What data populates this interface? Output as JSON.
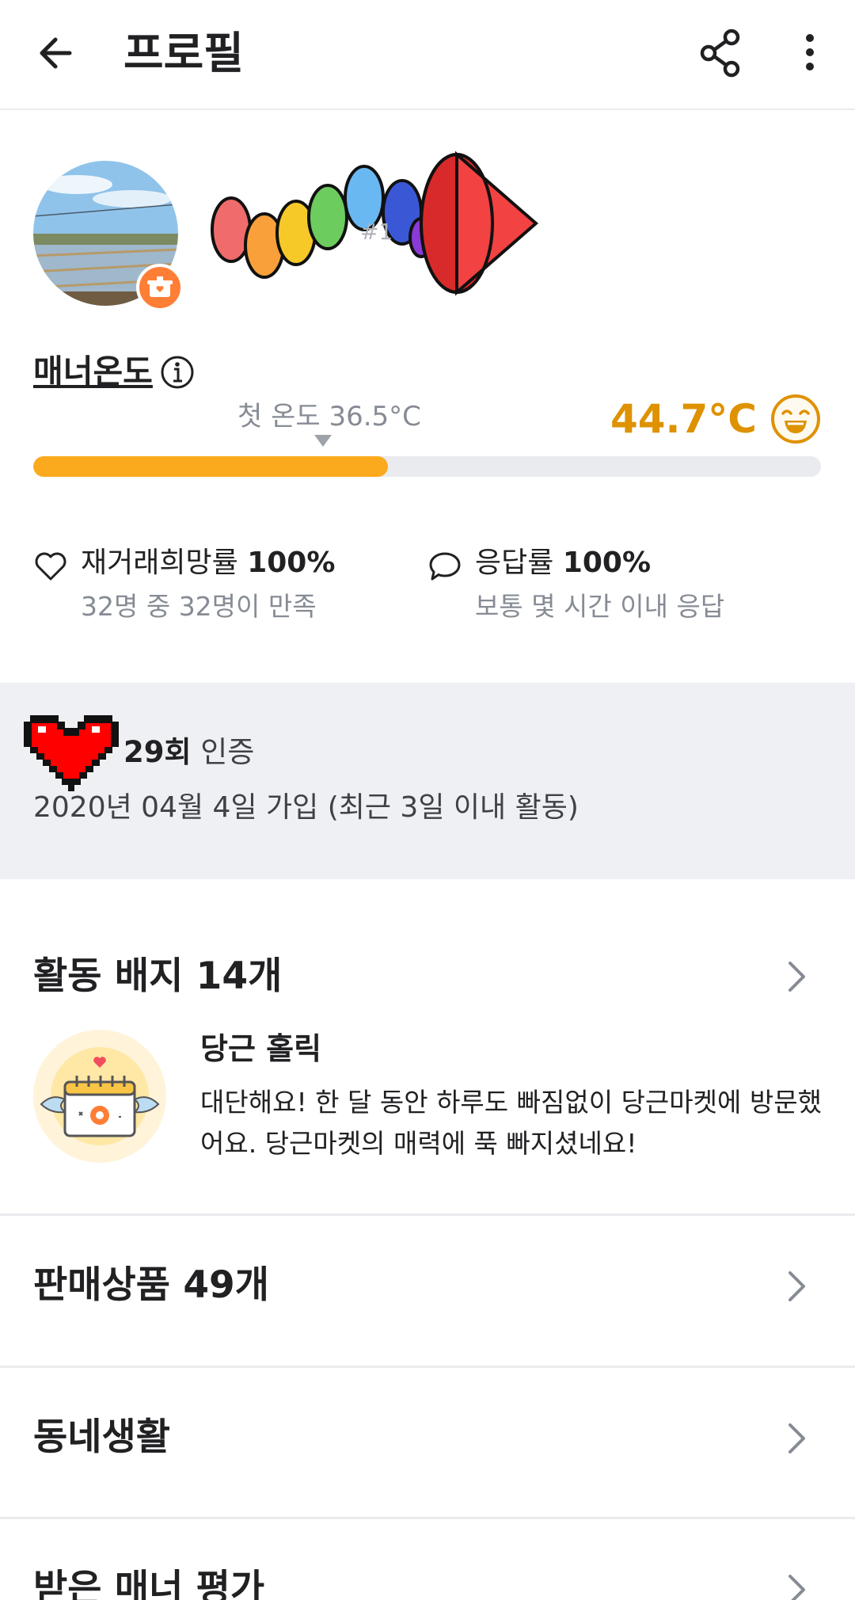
{
  "header": {
    "title": "프로필",
    "back_icon": "arrow-left-icon",
    "share_icon": "share-icon",
    "more_icon": "more-vertical-icon"
  },
  "profile": {
    "user_id": "#1"
  },
  "manner": {
    "title": "매너온도",
    "first_temp_label": "첫 온도 36.5°C",
    "temperature": "44.7°C",
    "temperature_value": 44.7,
    "bar_fill_percent": 45,
    "accent_color": "#de9200",
    "bar_color": "#fbaa1d"
  },
  "stats": [
    {
      "icon": "heart-outline-icon",
      "label": "재거래희망률",
      "value": "100%",
      "sub": "32명 중 32명이 만족"
    },
    {
      "icon": "chat-bubble-icon",
      "label": "응답률",
      "value": "100%",
      "sub": "보통 몇 시간 이내 응답"
    }
  ],
  "certification": {
    "count": "29회",
    "label": "인증",
    "joined": "2020년 04월 4일 가입 (최근 3일 이내 활동)"
  },
  "badges": {
    "title": "활동 배지 14개",
    "featured": {
      "name": "당근 홀릭",
      "description": "대단해요! 한 달 동안 하루도 빠짐없이 당근마켓에 방문했어요. 당근마켓의 매력에 푹 빠지셨네요!"
    }
  },
  "sections": {
    "products": "판매상품 49개",
    "neighborhood": "동네생활",
    "reviews": "받은 매너 평가"
  }
}
